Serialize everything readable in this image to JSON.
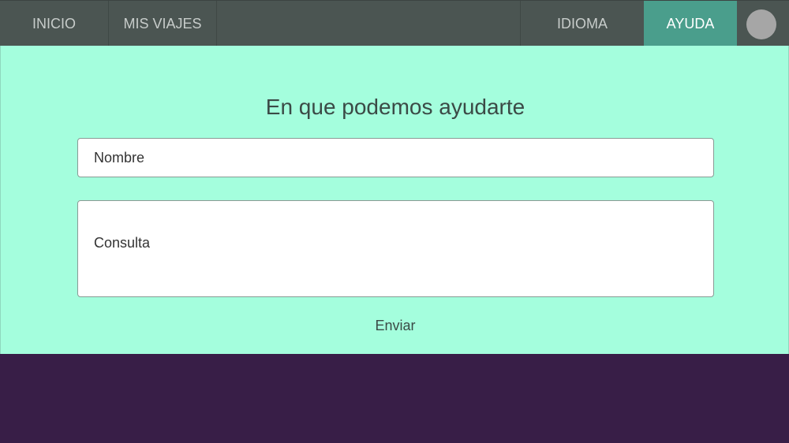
{
  "nav": {
    "inicio": "INICIO",
    "mis_viajes": "MIS VIAJES",
    "idioma": "IDIOMA",
    "ayuda": "AYUDA",
    "active_color": "#4a9e8c"
  },
  "help_form": {
    "title": "En que podemos ayudarte",
    "name_placeholder": "Nombre",
    "query_placeholder": "Consulta",
    "submit_label": "Enviar"
  },
  "colors": {
    "navbar": "#4b5552",
    "panel": "#a4fedd",
    "footer": "#381e47"
  }
}
